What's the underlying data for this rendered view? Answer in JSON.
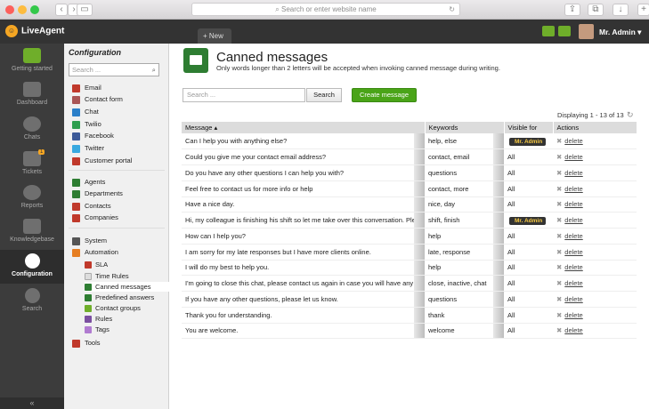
{
  "browser": {
    "url_placeholder": "Search or enter website name"
  },
  "app": {
    "name": "LiveAgent",
    "new_tab": "+ New",
    "user": "Mr. Admin"
  },
  "leftnav": [
    {
      "label": "Getting started"
    },
    {
      "label": "Dashboard"
    },
    {
      "label": "Chats"
    },
    {
      "label": "Tickets",
      "badge": "1"
    },
    {
      "label": "Reports"
    },
    {
      "label": "Knowledgebase"
    },
    {
      "label": "Configuration"
    },
    {
      "label": "Search"
    }
  ],
  "config": {
    "title": "Configuration",
    "search_placeholder": "Search ...",
    "items": [
      "Email",
      "Contact form",
      "Chat",
      "Twilio",
      "Facebook",
      "Twitter",
      "Customer portal",
      "Agents",
      "Departments",
      "Contacts",
      "Companies",
      "System",
      "Automation",
      "SLA",
      "Time Rules",
      "Canned messages",
      "Predefined answers",
      "Contact groups",
      "Rules",
      "Tags",
      "Tools"
    ]
  },
  "page": {
    "title": "Canned messages",
    "subtitle": "Only words longer than 2 letters will be accepted when invoking canned message during writing.",
    "search_placeholder": "Search ...",
    "search_button": "Search",
    "create_button": "Create message",
    "displaying": "Displaying 1 - 13 of 13"
  },
  "table": {
    "headers": [
      "Message",
      "Keywords",
      "Visible for",
      "Actions"
    ],
    "delete_label": "delete",
    "rows": [
      {
        "message": "Can I help you with anything else?",
        "keywords": "help, else",
        "visible": "Mr. Admin",
        "badge": true
      },
      {
        "message": "Could you give me your contact email address?",
        "keywords": "contact, email",
        "visible": "All",
        "badge": false
      },
      {
        "message": "Do you have any other questions I can help you with?",
        "keywords": "questions",
        "visible": "All",
        "badge": false
      },
      {
        "message": "Feel free to contact us for more info or help",
        "keywords": "contact, more",
        "visible": "All",
        "badge": false
      },
      {
        "message": "Have a nice day.",
        "keywords": "nice, day",
        "visible": "All",
        "badge": false
      },
      {
        "message": "Hi, my colleague is finishing his shift so let me take over this conversation. Please g",
        "keywords": "shift, finish",
        "visible": "Mr. Admin",
        "badge": true
      },
      {
        "message": "How can I help you?",
        "keywords": "help",
        "visible": "All",
        "badge": false
      },
      {
        "message": "I am sorry for my late responses but I have more clients online.",
        "keywords": "late, response",
        "visible": "All",
        "badge": false
      },
      {
        "message": "I will do my best to help you.",
        "keywords": "help",
        "visible": "All",
        "badge": false
      },
      {
        "message": "I'm going to close this chat, please contact us again in case you will have any other q",
        "keywords": "close, inactive, chat",
        "visible": "All",
        "badge": false
      },
      {
        "message": "If you have any other questions, please let us know.",
        "keywords": "questions",
        "visible": "All",
        "badge": false
      },
      {
        "message": "Thank you for understanding.",
        "keywords": "thank",
        "visible": "All",
        "badge": false
      },
      {
        "message": "You are welcome.",
        "keywords": "welcome",
        "visible": "All",
        "badge": false
      }
    ]
  }
}
